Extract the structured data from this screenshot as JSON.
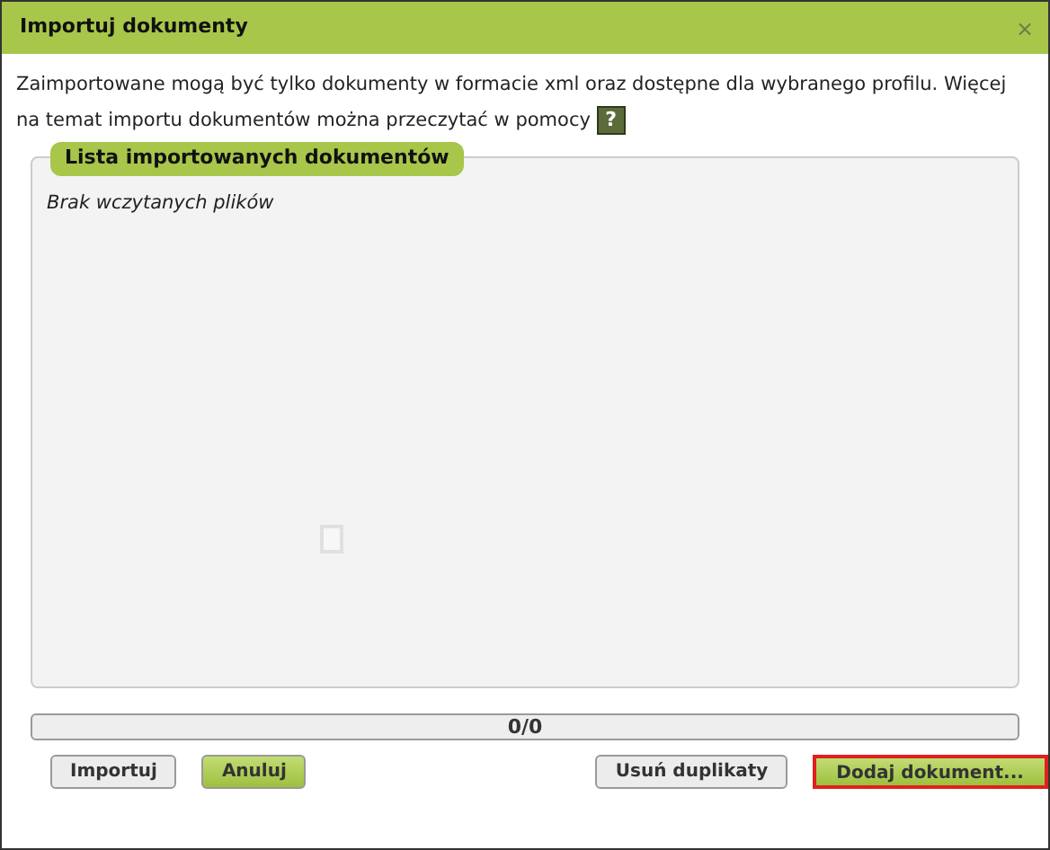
{
  "window": {
    "title": "Importuj dokumenty",
    "close": "×"
  },
  "info": {
    "text": "Zaimportowane mogą być tylko dokumenty w formacie xml oraz dostępne dla wybranego profilu. Więcej na temat importu dokumentów można przeczytać w pomocy",
    "help": "?"
  },
  "list": {
    "title": "Lista importowanych dokumentów",
    "empty": "Brak wczytanych plików"
  },
  "progress": {
    "text": "0/0",
    "level": 0
  },
  "buttons": [
    {
      "label": "Importuj",
      "kind": "default",
      "focused": false
    },
    {
      "label": "Anuluj",
      "kind": "green",
      "focused": false
    },
    {
      "label": "Usuń duplikaty",
      "kind": "default",
      "focused": false
    },
    {
      "label": "Dodaj dokument...",
      "kind": "green",
      "focused": true
    }
  ]
}
